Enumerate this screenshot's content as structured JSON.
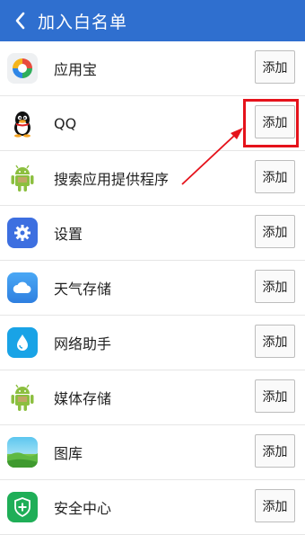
{
  "header": {
    "title": "加入白名单",
    "back_icon": "chevron-left-icon"
  },
  "items": [
    {
      "label": "应用宝",
      "icon": "yingyongbao-icon",
      "button": "添加"
    },
    {
      "label": "QQ",
      "icon": "qq-penguin-icon",
      "button": "添加"
    },
    {
      "label": "搜索应用提供程序",
      "icon": "android-icon",
      "button": "添加"
    },
    {
      "label": "设置",
      "icon": "gear-icon",
      "button": "添加"
    },
    {
      "label": "天气存储",
      "icon": "cloud-icon",
      "button": "添加"
    },
    {
      "label": "网络助手",
      "icon": "water-drop-icon",
      "button": "添加"
    },
    {
      "label": "媒体存储",
      "icon": "android-icon",
      "button": "添加"
    },
    {
      "label": "图库",
      "icon": "landscape-icon",
      "button": "添加"
    },
    {
      "label": "安全中心",
      "icon": "shield-plus-icon",
      "button": "添加"
    }
  ],
  "colors": {
    "header": "#2f6fcf",
    "annotation": "#e5121b"
  }
}
